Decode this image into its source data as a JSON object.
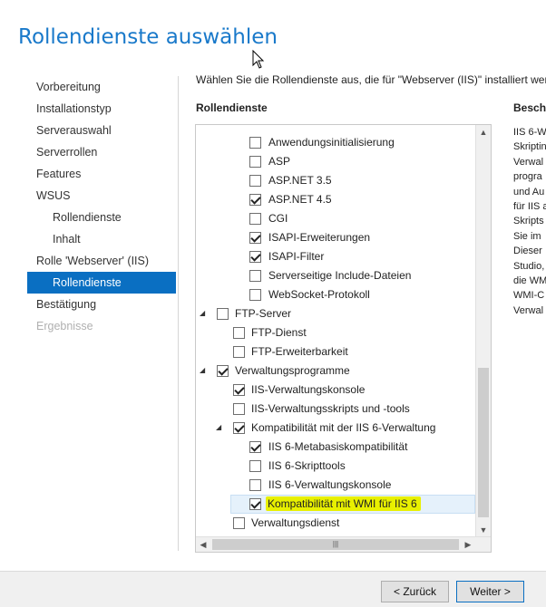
{
  "page": {
    "title": "Rollendienste auswählen",
    "intro": "Wählen Sie die Rollendienste aus, die für \"Webserver (IIS)\" installiert werd",
    "col_roles": "Rollendienste",
    "col_description": "Beschr"
  },
  "nav": {
    "items": [
      {
        "label": "Vorbereitung"
      },
      {
        "label": "Installationstyp"
      },
      {
        "label": "Serverauswahl"
      },
      {
        "label": "Serverrollen"
      },
      {
        "label": "Features"
      },
      {
        "label": "WSUS"
      },
      {
        "label": "Rollendienste"
      },
      {
        "label": "Inhalt"
      },
      {
        "label": "Rolle 'Webserver' (IIS)"
      },
      {
        "label": "Rollendienste"
      },
      {
        "label": "Bestätigung"
      },
      {
        "label": "Ergebnisse"
      }
    ]
  },
  "tree": {
    "items": [
      {
        "label": "Anwendungsinitialisierung",
        "checked": false
      },
      {
        "label": "ASP",
        "checked": false
      },
      {
        "label": "ASP.NET 3.5",
        "checked": false
      },
      {
        "label": "ASP.NET 4.5",
        "checked": true
      },
      {
        "label": "CGI",
        "checked": false
      },
      {
        "label": "ISAPI-Erweiterungen",
        "checked": true
      },
      {
        "label": "ISAPI-Filter",
        "checked": true
      },
      {
        "label": "Serverseitige Include-Dateien",
        "checked": false
      },
      {
        "label": "WebSocket-Protokoll",
        "checked": false
      },
      {
        "label": "FTP-Server",
        "checked": false,
        "expanded": true
      },
      {
        "label": "FTP-Dienst",
        "checked": false
      },
      {
        "label": "FTP-Erweiterbarkeit",
        "checked": false
      },
      {
        "label": "Verwaltungsprogramme",
        "checked": true,
        "expanded": true
      },
      {
        "label": "IIS-Verwaltungskonsole",
        "checked": true
      },
      {
        "label": "IIS-Verwaltungsskripts und -tools",
        "checked": false
      },
      {
        "label": "Kompatibilität mit der IIS 6-Verwaltung",
        "checked": true,
        "expanded": true
      },
      {
        "label": "IIS 6-Metabasiskompatibilität",
        "checked": true
      },
      {
        "label": "IIS 6-Skripttools",
        "checked": false
      },
      {
        "label": "IIS 6-Verwaltungskonsole",
        "checked": false
      },
      {
        "label": "Kompatibilität mit WMI für IIS 6",
        "checked": true,
        "selected": true
      },
      {
        "label": "Verwaltungsdienst",
        "checked": false
      }
    ]
  },
  "description": {
    "lines": [
      "IIS 6-W",
      "Skriptin",
      "Verwal",
      "progra",
      "und Au",
      "für IIS a",
      "Skripts",
      "Sie im",
      "Dieser",
      "Studio,",
      "die WM",
      "WMI-C",
      "Verwal"
    ]
  },
  "footer": {
    "back_label": "< Zurück",
    "next_label": "Weiter >"
  },
  "colors": {
    "accent": "#1979ca",
    "selected_nav": "#0a6fc2",
    "highlight_marker": "#e8f000"
  }
}
